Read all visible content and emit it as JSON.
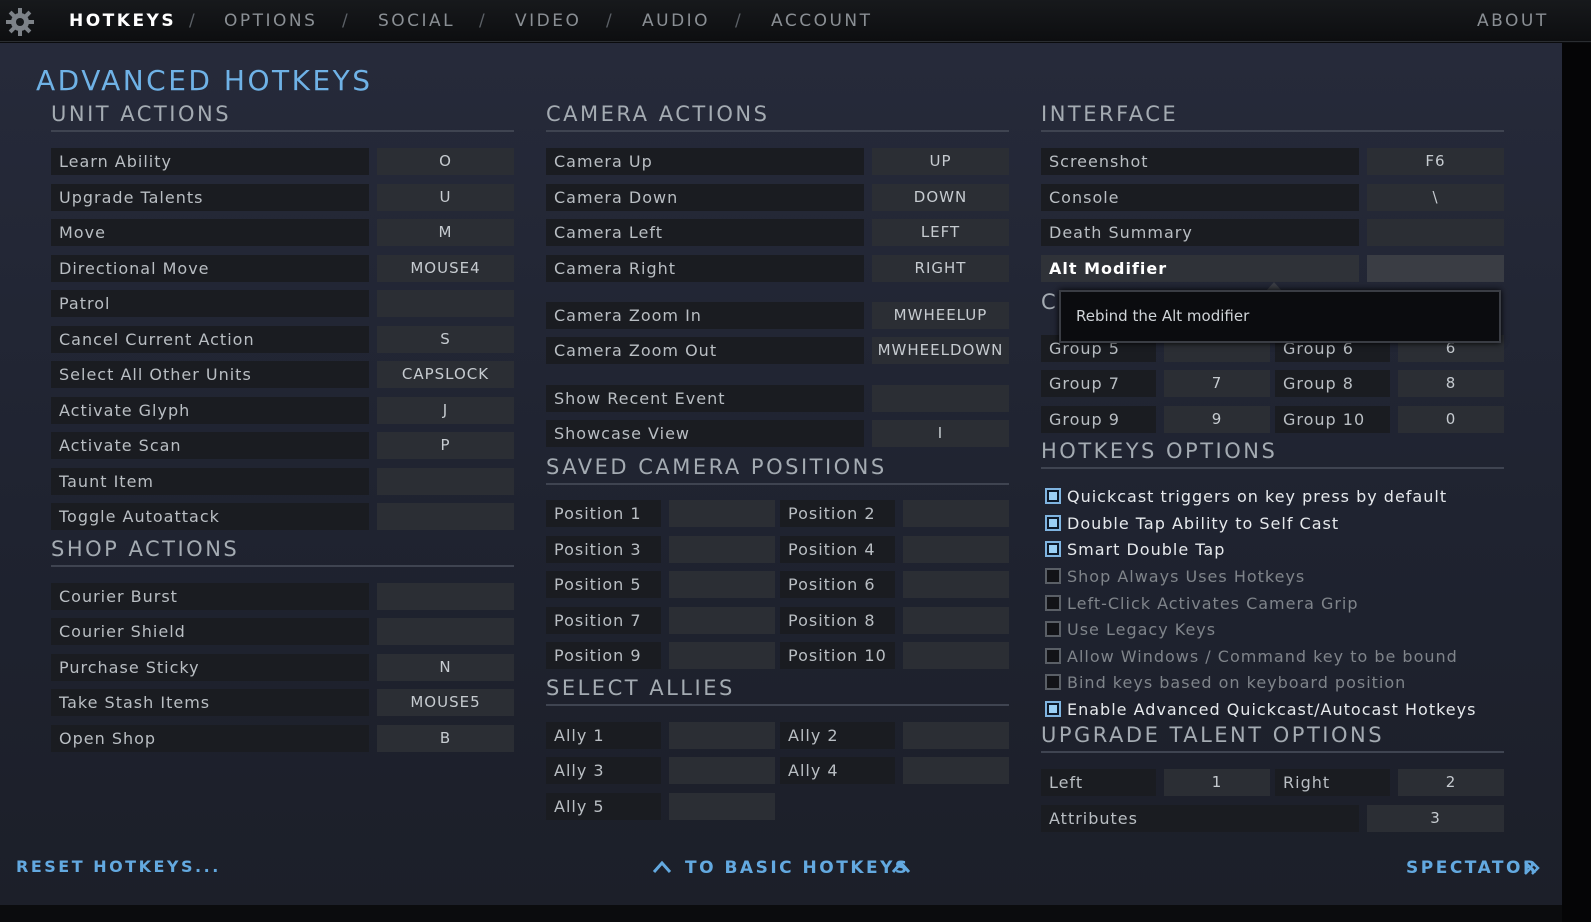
{
  "nav": {
    "tabs": [
      "HOTKEYS",
      "OPTIONS",
      "SOCIAL",
      "VIDEO",
      "AUDIO",
      "ACCOUNT"
    ],
    "separator": "/",
    "about": "ABOUT"
  },
  "page_title": "ADVANCED HOTKEYS",
  "unit_actions": {
    "title": "UNIT ACTIONS",
    "rows": [
      {
        "label": "Learn Ability",
        "key": "O"
      },
      {
        "label": "Upgrade Talents",
        "key": "U"
      },
      {
        "label": "Move",
        "key": "M"
      },
      {
        "label": "Directional Move",
        "key": "MOUSE4"
      },
      {
        "label": "Patrol",
        "key": ""
      },
      {
        "label": "Cancel Current Action",
        "key": "S"
      },
      {
        "label": "Select All Other Units",
        "key": "CAPSLOCK"
      },
      {
        "label": "Activate Glyph",
        "key": "J"
      },
      {
        "label": "Activate Scan",
        "key": "P"
      },
      {
        "label": "Taunt Item",
        "key": ""
      },
      {
        "label": "Toggle Autoattack",
        "key": ""
      }
    ]
  },
  "shop_actions": {
    "title": "SHOP ACTIONS",
    "rows": [
      {
        "label": "Courier Burst",
        "key": ""
      },
      {
        "label": "Courier Shield",
        "key": ""
      },
      {
        "label": "Purchase Sticky",
        "key": "N"
      },
      {
        "label": "Take Stash Items",
        "key": "MOUSE5"
      },
      {
        "label": "Open Shop",
        "key": "B"
      }
    ]
  },
  "camera_actions": {
    "title": "CAMERA ACTIONS",
    "rows": [
      {
        "label": "Camera Up",
        "key": "UP"
      },
      {
        "label": "Camera Down",
        "key": "DOWN"
      },
      {
        "label": "Camera Left",
        "key": "LEFT"
      },
      {
        "label": "Camera Right",
        "key": "RIGHT"
      },
      {
        "label": "Camera Zoom In",
        "key": "MWHEELUP"
      },
      {
        "label": "Camera Zoom Out",
        "key": "MWHEELDOWN"
      },
      {
        "label": "Show Recent Event",
        "key": ""
      },
      {
        "label": "Showcase View",
        "key": "I"
      }
    ]
  },
  "saved_camera": {
    "title": "SAVED CAMERA POSITIONS",
    "rows": [
      {
        "label": "Position 1",
        "key": ""
      },
      {
        "label": "Position 2",
        "key": ""
      },
      {
        "label": "Position 3",
        "key": ""
      },
      {
        "label": "Position 4",
        "key": ""
      },
      {
        "label": "Position 5",
        "key": ""
      },
      {
        "label": "Position 6",
        "key": ""
      },
      {
        "label": "Position 7",
        "key": ""
      },
      {
        "label": "Position 8",
        "key": ""
      },
      {
        "label": "Position 9",
        "key": ""
      },
      {
        "label": "Position 10",
        "key": ""
      }
    ]
  },
  "select_allies": {
    "title": "SELECT ALLIES",
    "rows": [
      {
        "label": "Ally 1",
        "key": ""
      },
      {
        "label": "Ally 2",
        "key": ""
      },
      {
        "label": "Ally 3",
        "key": ""
      },
      {
        "label": "Ally 4",
        "key": ""
      },
      {
        "label": "Ally 5",
        "key": ""
      }
    ]
  },
  "interface": {
    "title": "INTERFACE",
    "rows": [
      {
        "label": "Screenshot",
        "key": "F6"
      },
      {
        "label": "Console",
        "key": "\\"
      },
      {
        "label": "Death Summary",
        "key": ""
      },
      {
        "label": "Alt Modifier",
        "key": ""
      }
    ]
  },
  "tooltip": {
    "partial_heading": "C",
    "text": "Rebind the Alt modifier"
  },
  "control_groups": {
    "rows": [
      {
        "label": "Group 5",
        "key": ""
      },
      {
        "label": "Group 6",
        "key": "6"
      },
      {
        "label": "Group 7",
        "key": "7"
      },
      {
        "label": "Group 8",
        "key": "8"
      },
      {
        "label": "Group 9",
        "key": "9"
      },
      {
        "label": "Group 10",
        "key": "0"
      }
    ]
  },
  "hotkeys_options": {
    "title": "HOTKEYS OPTIONS",
    "items": [
      {
        "label": "Quickcast triggers on key press by default",
        "checked": true
      },
      {
        "label": "Double Tap Ability to Self Cast",
        "checked": true
      },
      {
        "label": "Smart Double Tap",
        "checked": true
      },
      {
        "label": "Shop Always Uses Hotkeys",
        "checked": false
      },
      {
        "label": "Left-Click Activates Camera Grip",
        "checked": false
      },
      {
        "label": "Use Legacy Keys",
        "checked": false
      },
      {
        "label": "Allow Windows / Command key to be bound",
        "checked": false
      },
      {
        "label": "Bind keys based on keyboard position",
        "checked": false
      },
      {
        "label": "Enable Advanced Quickcast/Autocast Hotkeys",
        "checked": true
      }
    ]
  },
  "upgrade_talent": {
    "title": "UPGRADE TALENT OPTIONS",
    "rows": [
      {
        "label": "Left",
        "key": "1"
      },
      {
        "label": "Right",
        "key": "2"
      },
      {
        "label": "Attributes",
        "key": "3"
      }
    ]
  },
  "footer": {
    "reset": "RESET HOTKEYS...",
    "basic": "TO BASIC HOTKEYS",
    "spectator": "SPECTATOR"
  },
  "colors": {
    "accent": "#6fb2e6",
    "link": "#63a9e0"
  }
}
